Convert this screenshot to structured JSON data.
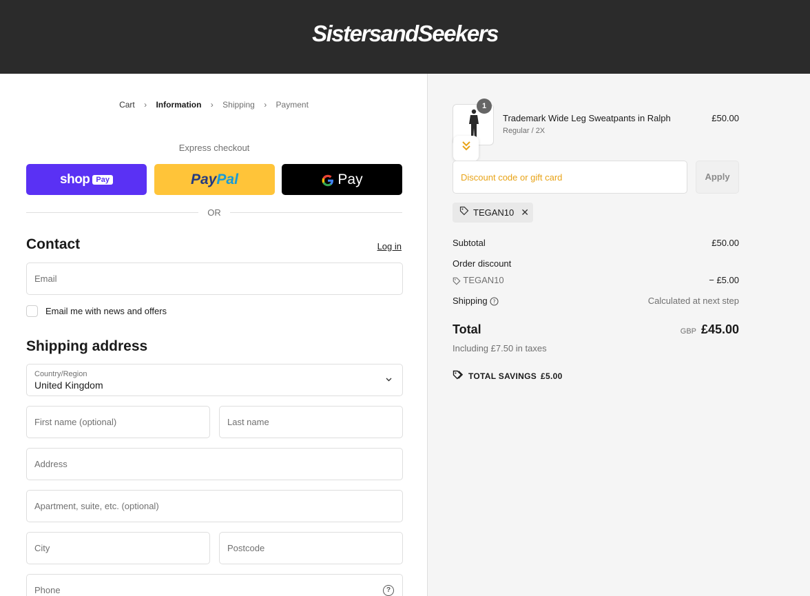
{
  "header": {
    "logo": "SistersandSeekers"
  },
  "breadcrumb": [
    {
      "label": "Cart",
      "state": "link"
    },
    {
      "label": "Information",
      "state": "active"
    },
    {
      "label": "Shipping",
      "state": "inactive"
    },
    {
      "label": "Payment",
      "state": "inactive"
    }
  ],
  "express": {
    "label": "Express checkout",
    "shop": {
      "text": "shop",
      "badge": "Pay"
    },
    "paypal": {
      "part1": "Pay",
      "part2": "Pal"
    },
    "gpay": {
      "g": "G",
      "text": "Pay"
    },
    "or": "OR"
  },
  "contact": {
    "title": "Contact",
    "login": "Log in",
    "email_placeholder": "Email",
    "newsletter_label": "Email me with news and offers"
  },
  "shipping": {
    "title": "Shipping address",
    "country_label": "Country/Region",
    "country_value": "United Kingdom",
    "first_name": "First name (optional)",
    "last_name": "Last name",
    "address": "Address",
    "apartment": "Apartment, suite, etc. (optional)",
    "city": "City",
    "postcode": "Postcode",
    "phone": "Phone"
  },
  "summary": {
    "product": {
      "name": "Trademark Wide Leg Sweatpants in Ralph",
      "variant": "Regular / 2X",
      "price": "£50.00",
      "quantity": "1"
    },
    "discount_placeholder": "Discount code or gift card",
    "apply": "Apply",
    "applied_code": "TEGAN10",
    "subtotal_label": "Subtotal",
    "subtotal_value": "£50.00",
    "order_discount_label": "Order discount",
    "discount_code": "TEGAN10",
    "discount_value": "− £5.00",
    "shipping_label": "Shipping",
    "shipping_value": "Calculated at next step",
    "total_label": "Total",
    "currency": "GBP",
    "total_value": "£45.00",
    "taxes": "Including £7.50 in taxes",
    "savings_label": "TOTAL SAVINGS",
    "savings_value": "£5.00"
  },
  "colors": {
    "header_bg": "#2b2b2b",
    "shop_pay": "#5a31f4",
    "paypal": "#ffc439",
    "gpay": "#000000",
    "accent_orange": "#e8a317"
  }
}
